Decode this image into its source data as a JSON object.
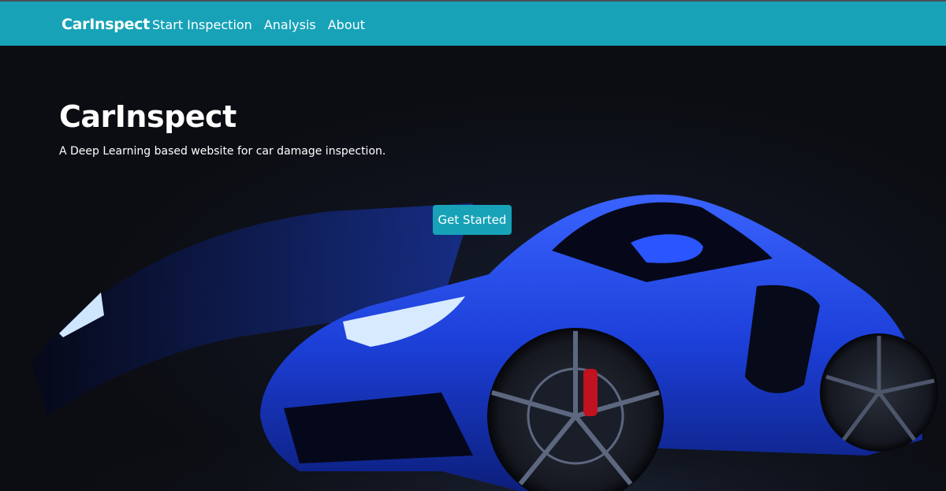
{
  "navbar": {
    "brand": "CarInspect",
    "links": [
      "Start Inspection",
      "Analysis",
      "About"
    ]
  },
  "hero": {
    "title": "CarInspect",
    "subtitle": "A Deep Learning based website for car damage inspection.",
    "cta_label": "Get Started"
  },
  "colors": {
    "navbar_bg": "#17a2b8",
    "hero_bg": "#0b0d12",
    "car_body": "#1f47e6",
    "button_bg": "#17a2b8"
  }
}
